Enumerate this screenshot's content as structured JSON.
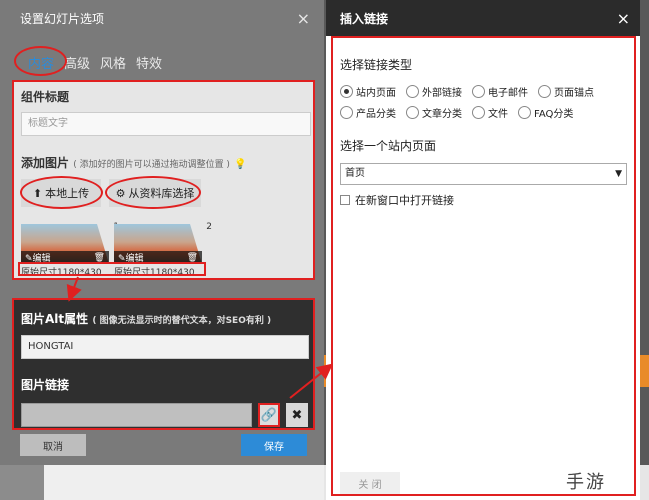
{
  "left_dialog": {
    "title": "设置幻灯片选项",
    "close_glyph": "×",
    "tabs": [
      {
        "label": "内容",
        "active": true
      },
      {
        "label": "高级",
        "active": false
      },
      {
        "label": "风格",
        "active": false
      },
      {
        "label": "特效",
        "active": false
      }
    ],
    "component_title_label": "组件标题",
    "title_placeholder": "标题文字",
    "add_image_label": "添加图片",
    "add_image_note": "( 添加好的图片可以通过拖动调整位置 )",
    "upload_button": "本地上传",
    "library_button": "从资料库选择",
    "images": [
      {
        "index": "1",
        "edit": "编辑",
        "size": "原始尺寸1180*430"
      },
      {
        "index": "2",
        "edit": "编辑",
        "size": "原始尺寸1180*430"
      }
    ],
    "alt_label": "图片Alt属性",
    "alt_note": "( 图像无法显示时的替代文本，对SEO有利 )",
    "alt_value": "HONGTAI",
    "link_label": "图片链接",
    "link_value": "",
    "cancel_button": "取消",
    "save_button": "保存"
  },
  "right_dialog": {
    "title": "插入链接",
    "close_glyph": "×",
    "link_type_label": "选择链接类型",
    "link_types": [
      {
        "label": "站内页面",
        "selected": true
      },
      {
        "label": "外部链接",
        "selected": false
      },
      {
        "label": "电子邮件",
        "selected": false
      },
      {
        "label": "页面锚点",
        "selected": false
      },
      {
        "label": "产品分类",
        "selected": false
      },
      {
        "label": "文章分类",
        "selected": false
      },
      {
        "label": "文件",
        "selected": false
      },
      {
        "label": "FAQ分类",
        "selected": false
      }
    ],
    "page_select_label": "选择一个站内页面",
    "selected_page": "首页",
    "new_window_label": "在新窗口中打开链接",
    "close_button": "关 闭"
  },
  "watermark": "手游",
  "colors": {
    "accent": "#2d8bd7",
    "annotation": "#e02020"
  }
}
